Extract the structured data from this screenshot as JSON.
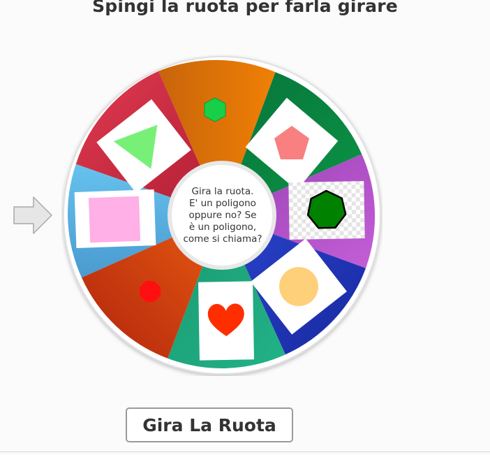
{
  "title": "Spingi la ruota per farla girare",
  "center_text_lines": [
    "Gira la ruota.",
    "E' un poligono",
    "oppure no? Se",
    "è un poligono,",
    "come si chiama?"
  ],
  "spin_button": {
    "label": "Gira La Ruota"
  },
  "wheel": {
    "segments": [
      {
        "id": "seg-orange",
        "color": "#f07a05",
        "color2": "#c8640a",
        "shape": "green-hexagon"
      },
      {
        "id": "seg-green",
        "color": "#0b8a3f",
        "color2": "#056c30",
        "shape": "salmon-pentagon-card"
      },
      {
        "id": "seg-purple",
        "color": "#b050c8",
        "color2": "#9b3fb5",
        "shape": "green-heptagon-card"
      },
      {
        "id": "seg-blue",
        "color": "#2035c0",
        "color2": "#1a2aa0",
        "shape": "yellow-circle-card"
      },
      {
        "id": "seg-teal",
        "color": "#1faa80",
        "color2": "#168a68",
        "shape": "red-heart-card"
      },
      {
        "id": "seg-red",
        "color": "#e14a10",
        "color2": "#b32c0e",
        "shape": "red-octagon"
      },
      {
        "id": "seg-sky",
        "color": "#5fb8e8",
        "color2": "#4a9fd3",
        "shape": "pink-square-card"
      },
      {
        "id": "seg-crimson",
        "color": "#d82e46",
        "color2": "#b21f35",
        "shape": "green-triangle-card"
      }
    ]
  }
}
